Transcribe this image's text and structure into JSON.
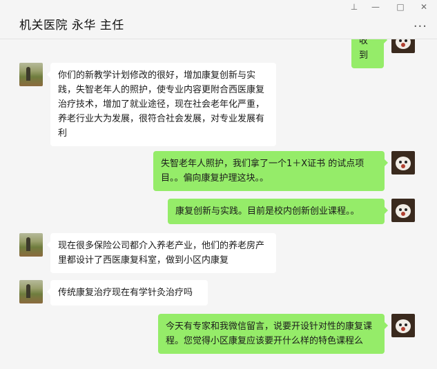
{
  "window": {
    "title": "机关医院 永华 主任",
    "controls": [
      "⊥",
      "—",
      "□",
      "✕"
    ],
    "more": "···"
  },
  "messages": [
    {
      "side": "out",
      "text": "收到"
    },
    {
      "side": "in",
      "text": "你们的新教学计划修改的很好，增加康复创新与实践，失智老年人的照护，使专业内容更附合西医康复治疗技术，增加了就业途径，现在社会老年化严重，养老行业大为发展，很符合社会发展，对专业发展有利"
    },
    {
      "side": "out",
      "text": "失智老年人照护，我们拿了一个1＋X证书 的试点项目。。偏向康复护理这块。。"
    },
    {
      "side": "out",
      "text": "康复创新与实践。目前是校内创新创业课程。。"
    },
    {
      "side": "in",
      "text": "现在很多保险公司都介入养老产业，他们的养老房产里都设计了西医康复科室，做到小区内康复"
    },
    {
      "side": "in",
      "text": "传统康复治疗现在有学针灸治疗吗"
    },
    {
      "side": "out",
      "text": "今天有专家和我微信留言，说要开设针对性的康复课程。您觉得小区康复应该要开什么样的特色课程么"
    }
  ]
}
